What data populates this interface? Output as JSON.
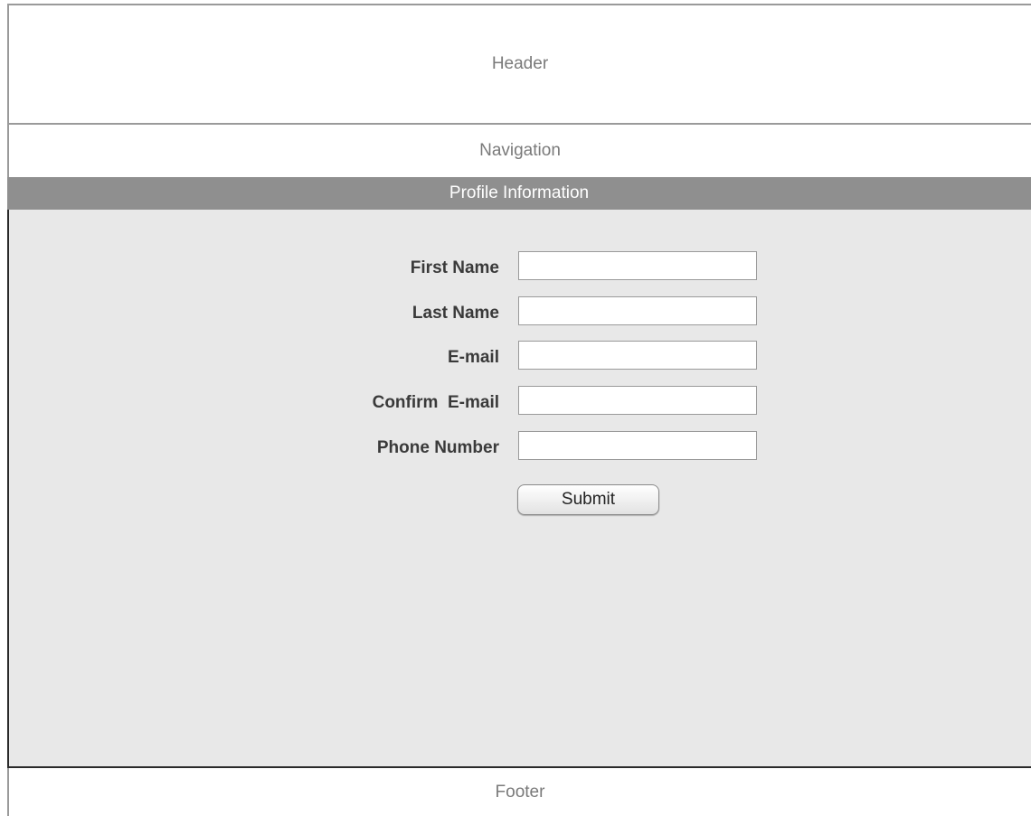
{
  "header": {
    "label": "Header"
  },
  "navigation": {
    "label": "Navigation"
  },
  "section": {
    "title": "Profile Information"
  },
  "form": {
    "fields": [
      {
        "label": "First Name",
        "value": ""
      },
      {
        "label": "Last Name",
        "value": ""
      },
      {
        "label": "E-mail",
        "value": ""
      },
      {
        "label": "Confirm  E-mail",
        "value": ""
      },
      {
        "label": "Phone Number",
        "value": ""
      }
    ],
    "submit_label": "Submit"
  },
  "footer": {
    "label": "Footer"
  },
  "colors": {
    "section_bar": "#8f8f8f",
    "content_background": "#e8e8e8",
    "placeholder_text": "#7a7a7a"
  }
}
